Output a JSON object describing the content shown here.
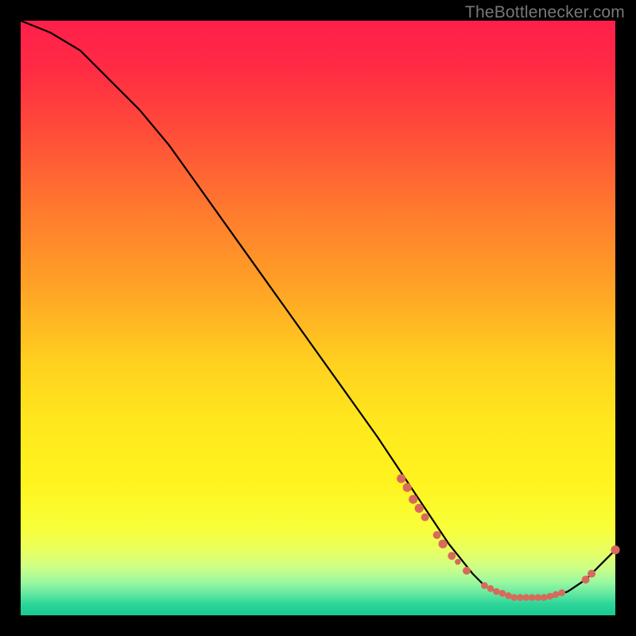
{
  "watermark": "TheBottlenecker.com",
  "colors": {
    "frame": "#000000",
    "line": "#000000",
    "marker": "#d86a5c"
  },
  "chart_data": {
    "type": "line",
    "title": "",
    "xlabel": "",
    "ylabel": "",
    "xlim": [
      0,
      100
    ],
    "ylim": [
      0,
      100
    ],
    "grid": false,
    "legend": false,
    "series": [
      {
        "name": "curve",
        "x": [
          0,
          5,
          10,
          15,
          20,
          25,
          30,
          35,
          40,
          45,
          50,
          55,
          60,
          64,
          68,
          72,
          76,
          78,
          80,
          83,
          86,
          89,
          92,
          95,
          98,
          100
        ],
        "values": [
          100,
          98,
          95,
          90,
          85,
          79,
          72,
          65,
          58,
          51,
          44,
          37,
          30,
          24,
          18,
          12,
          7,
          5,
          4,
          3,
          3,
          3,
          4,
          6,
          9,
          11
        ]
      }
    ],
    "markers": [
      {
        "x": 64.0,
        "y": 23.0,
        "r": 0.9
      },
      {
        "x": 65.0,
        "y": 21.5,
        "r": 0.9
      },
      {
        "x": 66.0,
        "y": 19.5,
        "r": 0.9
      },
      {
        "x": 67.0,
        "y": 18.0,
        "r": 0.9
      },
      {
        "x": 68.0,
        "y": 16.5,
        "r": 0.8
      },
      {
        "x": 70.0,
        "y": 13.5,
        "r": 0.8
      },
      {
        "x": 71.0,
        "y": 12.0,
        "r": 0.9
      },
      {
        "x": 72.5,
        "y": 10.0,
        "r": 0.8
      },
      {
        "x": 73.5,
        "y": 9.0,
        "r": 0.6
      },
      {
        "x": 75.0,
        "y": 7.5,
        "r": 0.8
      },
      {
        "x": 78.0,
        "y": 5.0,
        "r": 0.7
      },
      {
        "x": 79.0,
        "y": 4.5,
        "r": 0.7
      },
      {
        "x": 80.0,
        "y": 4.0,
        "r": 0.7
      },
      {
        "x": 81.0,
        "y": 3.7,
        "r": 0.7
      },
      {
        "x": 82.0,
        "y": 3.3,
        "r": 0.7
      },
      {
        "x": 83.0,
        "y": 3.0,
        "r": 0.7
      },
      {
        "x": 84.0,
        "y": 3.0,
        "r": 0.7
      },
      {
        "x": 85.0,
        "y": 3.0,
        "r": 0.7
      },
      {
        "x": 86.0,
        "y": 3.0,
        "r": 0.7
      },
      {
        "x": 87.0,
        "y": 3.0,
        "r": 0.7
      },
      {
        "x": 88.0,
        "y": 3.0,
        "r": 0.7
      },
      {
        "x": 89.0,
        "y": 3.2,
        "r": 0.7
      },
      {
        "x": 90.0,
        "y": 3.5,
        "r": 0.7
      },
      {
        "x": 91.0,
        "y": 3.8,
        "r": 0.7
      },
      {
        "x": 95.0,
        "y": 6.0,
        "r": 0.8
      },
      {
        "x": 96.0,
        "y": 7.0,
        "r": 0.8
      },
      {
        "x": 100.0,
        "y": 11.0,
        "r": 0.9
      }
    ]
  }
}
